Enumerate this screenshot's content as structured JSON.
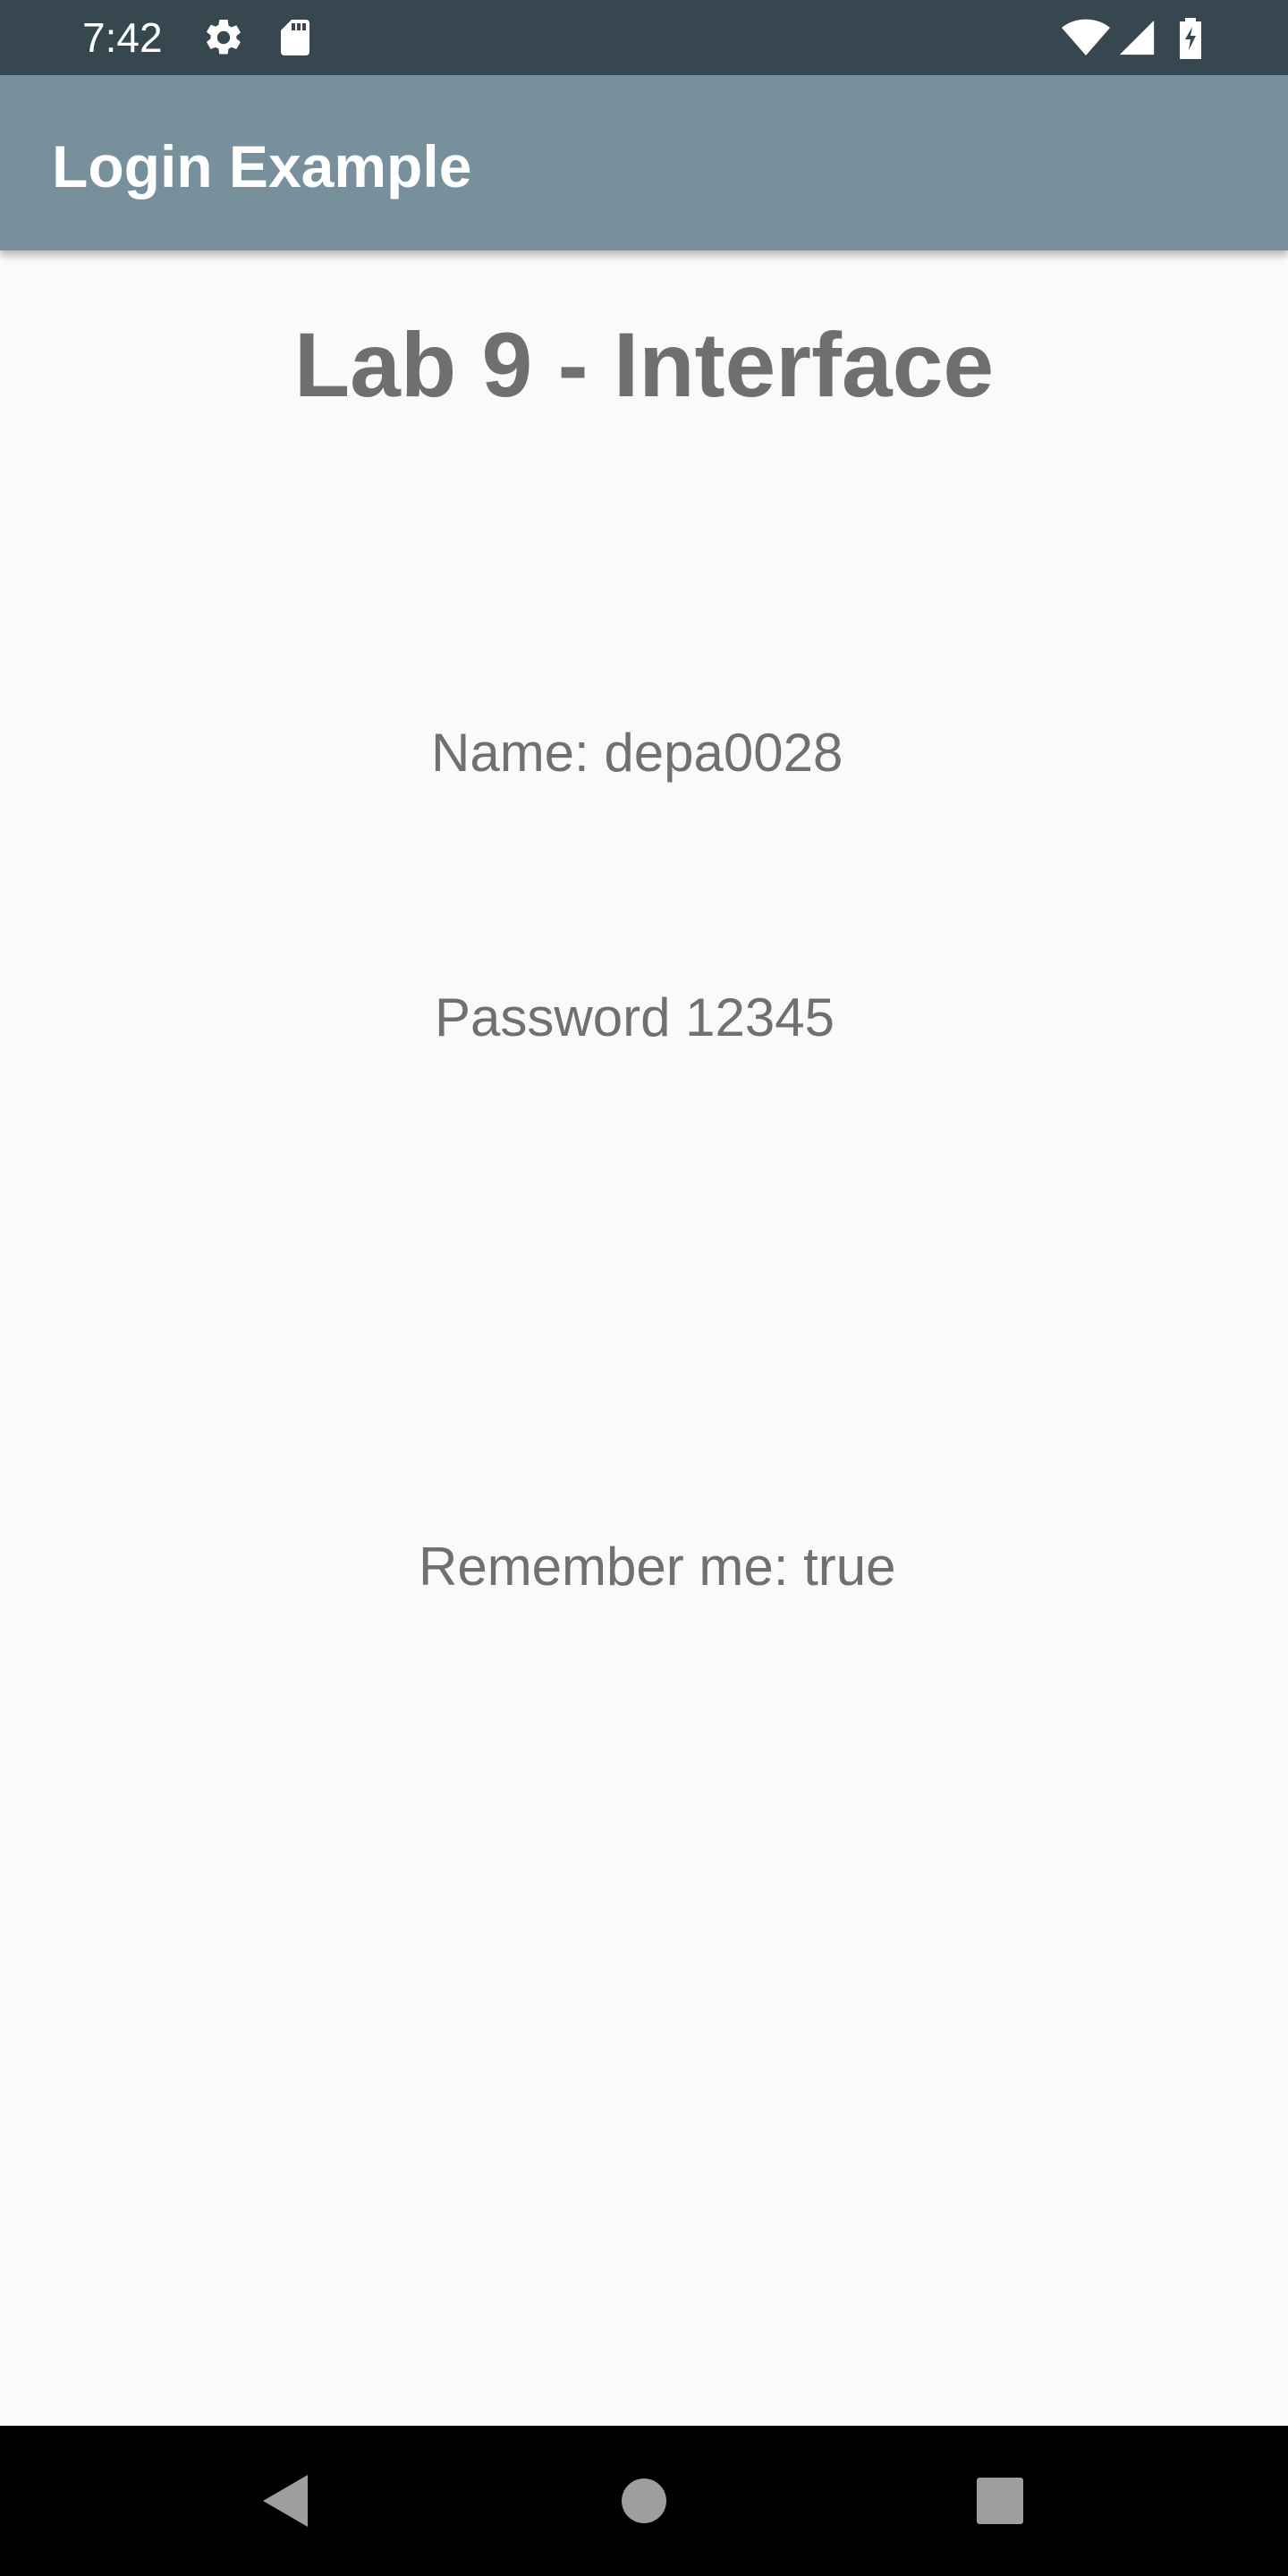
{
  "status_bar": {
    "time": "7:42",
    "icons": [
      "gear-icon",
      "sd-card-icon",
      "wifi-icon",
      "signal-icon",
      "battery-charging-icon"
    ],
    "background": "#37474f"
  },
  "app_bar": {
    "title": "Login Example",
    "background": "#78909c"
  },
  "content": {
    "heading": "Lab 9 - Interface",
    "name_line": "Name: depa0028",
    "password_line": "Password 12345",
    "remember_line": "Remember me: true"
  },
  "nav_bar": {
    "buttons": [
      "back-icon",
      "home-icon",
      "recents-icon"
    ]
  }
}
